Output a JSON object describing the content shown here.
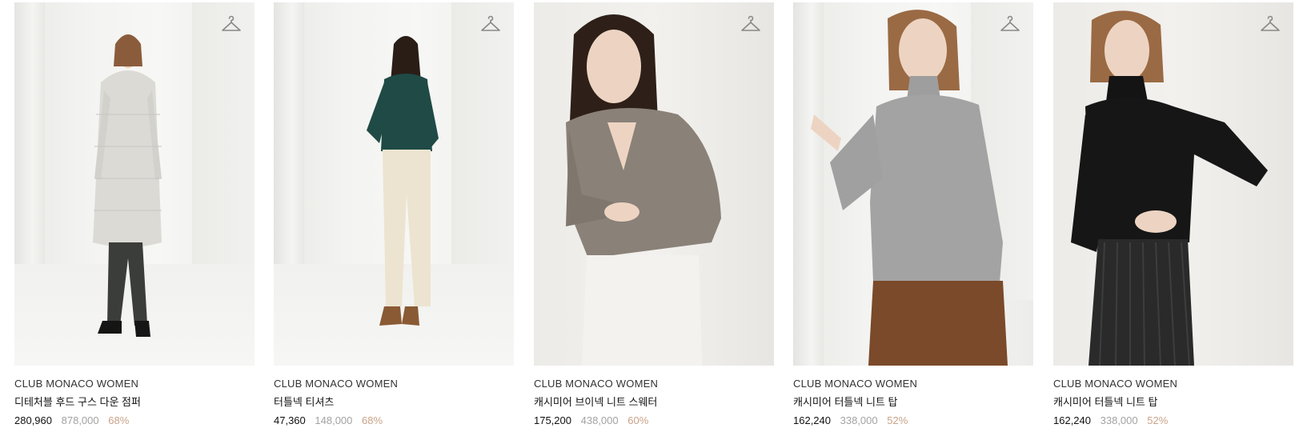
{
  "products": [
    {
      "brand": "CLUB MONACO WOMEN",
      "name": "디테처블 후드 구스 다운 점퍼",
      "price": "280,960",
      "original_price": "878,000",
      "discount": "68%",
      "icon": "hanger-icon"
    },
    {
      "brand": "CLUB MONACO WOMEN",
      "name": "터틀넥 티셔츠",
      "price": "47,360",
      "original_price": "148,000",
      "discount": "68%",
      "icon": "hanger-icon"
    },
    {
      "brand": "CLUB MONACO WOMEN",
      "name": "캐시미어 브이넥 니트 스웨터",
      "price": "175,200",
      "original_price": "438,000",
      "discount": "60%",
      "icon": "hanger-icon"
    },
    {
      "brand": "CLUB MONACO WOMEN",
      "name": "캐시미어 터틀넥 니트 탑",
      "price": "162,240",
      "original_price": "338,000",
      "discount": "52%",
      "icon": "hanger-icon"
    },
    {
      "brand": "CLUB MONACO WOMEN",
      "name": "캐시미어 터틀넥 니트 탑",
      "price": "162,240",
      "original_price": "338,000",
      "discount": "52%",
      "icon": "hanger-icon"
    }
  ],
  "colors": {
    "discount": "#c9a388",
    "original_price": "#a3a3a3",
    "text": "#111111"
  }
}
